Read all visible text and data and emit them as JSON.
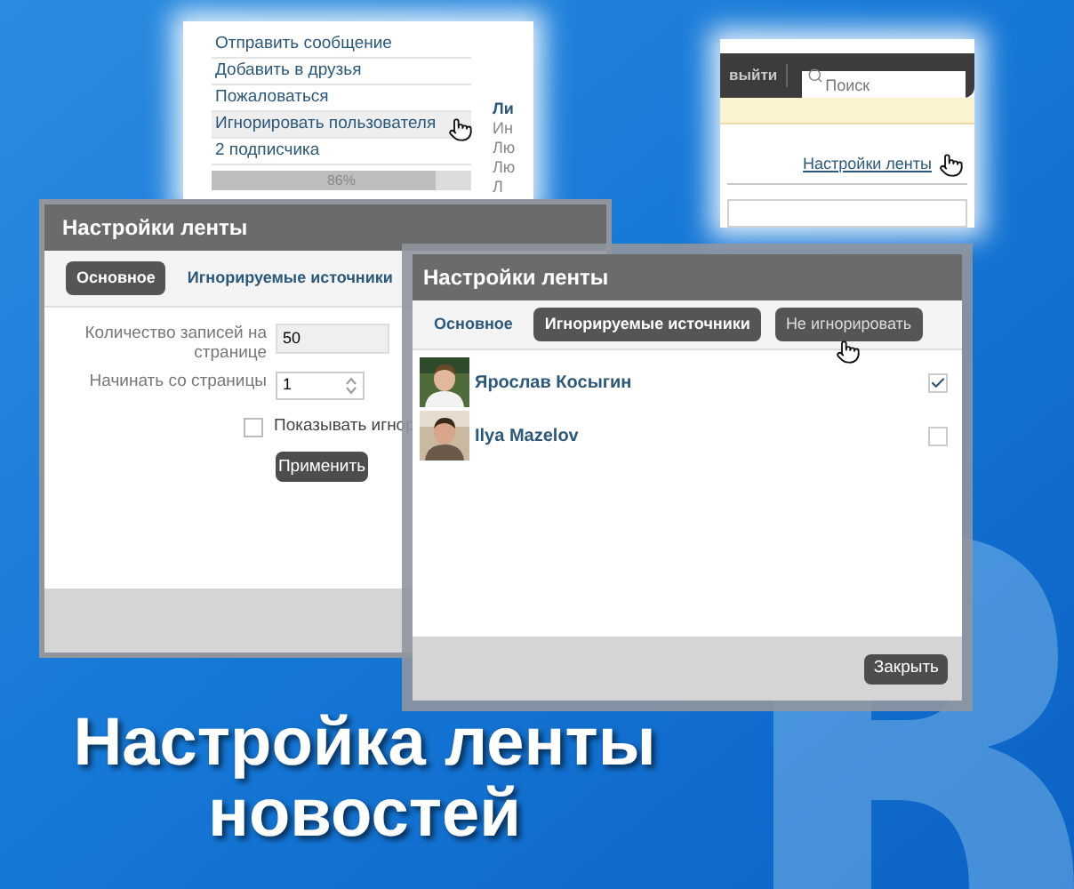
{
  "profile_menu": {
    "items": [
      {
        "label": "Отправить сообщение",
        "selected": false
      },
      {
        "label": "Добавить в друзья",
        "selected": false
      },
      {
        "label": "Пожаловаться",
        "selected": false
      },
      {
        "label": "Игнорировать пользователя",
        "selected": true
      },
      {
        "label": "2 подписчика",
        "selected": false
      }
    ],
    "progress": {
      "level": 0.86,
      "reading": "86%"
    },
    "column_2": {
      "heading": "Ли",
      "lines": [
        "Ин",
        "Лю",
        "Лю",
        "Л"
      ]
    }
  },
  "header_snippet": {
    "logout": "выйти",
    "search": {
      "placeholder": "Поиск"
    },
    "link": "Настройки ленты"
  },
  "dialog_general": {
    "title": "Настройки ленты",
    "tabs": [
      {
        "label": "Основное",
        "selected": true
      },
      {
        "label": "Игнорируемые источники",
        "selected": false
      }
    ],
    "fields": [
      {
        "label": "Количество записей на странице",
        "value": "50",
        "kind": "text"
      },
      {
        "label": "Начинать со страницы",
        "value": "1",
        "kind": "spinner"
      }
    ],
    "checkbox": {
      "label": "Показывать игнор",
      "checked": false
    },
    "apply_button": "Применить"
  },
  "dialog_ignored": {
    "title": "Настройки ленты",
    "tabs": [
      {
        "label": "Основное",
        "selected": false
      },
      {
        "label": "Игнорируемые источники",
        "selected": true
      }
    ],
    "action_button": "Не игнорировать",
    "rows": [
      {
        "name": "Ярослав Косыгин",
        "checked": true
      },
      {
        "name": "Ilya Mazelov",
        "checked": false
      }
    ],
    "close_button": "Закрыть"
  },
  "headline": [
    "Настройка ленты",
    "новостей"
  ]
}
